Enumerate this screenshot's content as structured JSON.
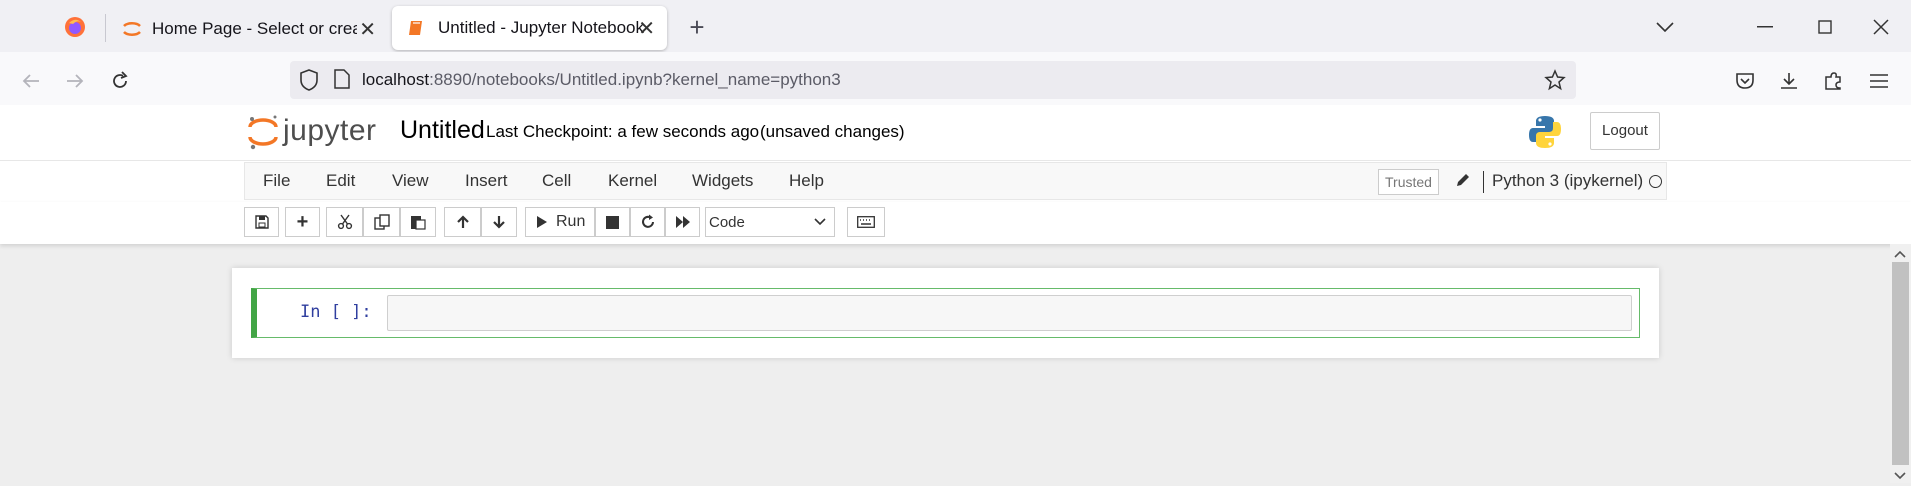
{
  "browser": {
    "tabs": [
      {
        "title": "Home Page - Select or create a notebook",
        "icon": "jupyter-logo-icon"
      },
      {
        "title": "Untitled - Jupyter Notebook",
        "icon": "notebook-icon"
      }
    ],
    "firefox_icon": "firefox-icon",
    "url_host": "localhost",
    "url_rest": ":8890/notebooks/Untitled.ipynb?kernel_name=python3"
  },
  "jupyter": {
    "logo_text": "jupyter",
    "notebook_name": "Untitled",
    "checkpoint": "Last Checkpoint: a few seconds ago",
    "unsaved": "(unsaved changes)",
    "logout_label": "Logout",
    "menu": [
      "File",
      "Edit",
      "View",
      "Insert",
      "Cell",
      "Kernel",
      "Widgets",
      "Help"
    ],
    "trusted_label": "Trusted",
    "kernel_name": "Python 3 (ipykernel)",
    "run_label": "Run",
    "cell_type": "Code",
    "cell_prompt": "In [ ]:",
    "cell_source": ""
  },
  "colors": {
    "accent_orange": "#f37726",
    "cell_border": "#42a545",
    "prompt_blue": "#303f9f"
  }
}
